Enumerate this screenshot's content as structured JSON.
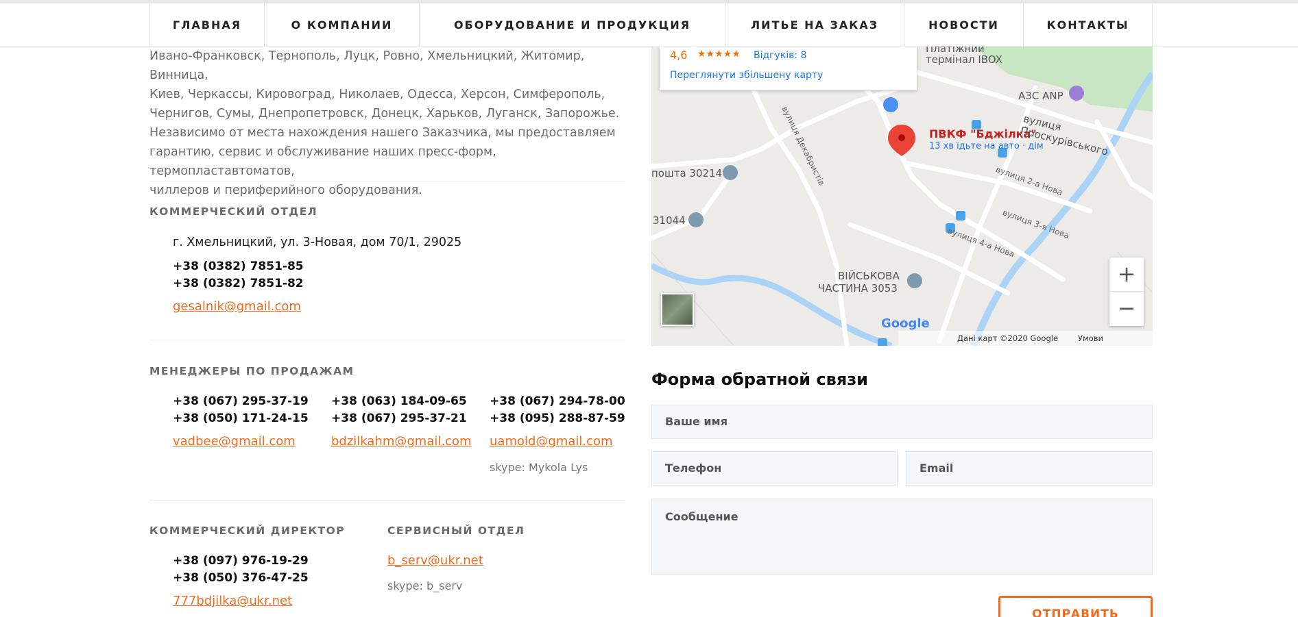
{
  "nav": [
    {
      "label": "ГЛАВНАЯ"
    },
    {
      "label": "О КОМПАНИИ"
    },
    {
      "label": "ОБОРУДОВАНИЕ И ПРОДУКЦИЯ"
    },
    {
      "label": "ЛИТЬЕ НА ЗАКАЗ"
    },
    {
      "label": "НОВОСТИ"
    },
    {
      "label": "КОНТАКТЫ"
    }
  ],
  "intro": {
    "lines": [
      "Ивано-Франковск, Тернополь, Луцк, Ровно, Хмельницкий, Житомир, Винница,",
      "Киев, Черкассы, Кировоград, Николаев, Одесса, Херсон, Симферополь,",
      "Чернигов, Сумы, Днепропетровск, Донецк, Харьков, Луганск, Запорожье.",
      "Независимо от места нахождения нашего Заказчика, мы предоставляем",
      "гарантию, сервис и обслуживание наших пресс-форм, термопластавтоматов,",
      "чиллеров и периферийного оборудования."
    ]
  },
  "commercial": {
    "title": "КОММЕРЧЕСКИЙ ОТДЕЛ",
    "address": "г. Хмельницкий, ул. 3-Новая, дом 70/1, 29025",
    "phones": [
      "+38 (0382) 7851-85",
      "+38 (0382) 7851-82"
    ],
    "email": "gesalnik@gmail.com"
  },
  "managers": {
    "title": "МЕНЕДЖЕРЫ ПО ПРОДАЖАМ",
    "items": [
      {
        "phones": [
          "+38 (067) 295-37-19",
          "+38 (050) 171-24-15"
        ],
        "email": "vadbee@gmail.com",
        "skype": ""
      },
      {
        "phones": [
          "+38 (063) 184-09-65",
          "+38 (067) 295-37-21"
        ],
        "email": "bdzilkahm@gmail.com",
        "skype": ""
      },
      {
        "phones": [
          "+38 (067) 294-78-00",
          "+38 (095) 288-87-59"
        ],
        "email": "uamold@gmail.com",
        "skype": "skype: Mykola Lys"
      }
    ]
  },
  "director": {
    "title": "КОММЕРЧЕСКИЙ ДИРЕКТОР",
    "phones": [
      "+38 (097) 976-19-29",
      "+38 (050) 376-47-25"
    ],
    "email": "777bdjilka@ukr.net"
  },
  "service": {
    "title": "СЕРВИСНЫЙ ОТДЕЛ",
    "email": "b_serv@ukr.net",
    "skype": "skype: b_serv"
  },
  "map": {
    "rating": "4,6",
    "stars": "★★★★★",
    "reviews": "Відгуків: 8",
    "view_larger": "Переглянути збільшену карту",
    "place_name": "ПВКФ \"Бджілка\"",
    "place_sub": "13 хв їдьте на авто · дім",
    "labels": {
      "terminal1": "Платіжний",
      "terminal2": "термінал IBOX",
      "azs": "АЗС ANP",
      "proskur": "вулиця Проскурівського",
      "post1": "пошта 30214",
      "post2": "31044",
      "decembr": "вулиця Декабристів",
      "nova2": "вулиця 2-а Нова",
      "nova3": "вулиця 3-я Нова",
      "nova4": "вулиця 4-а Нова",
      "military1": "ВІЙСЬКОВА",
      "military2": "ЧАСТИНА 3053",
      "google": "Google",
      "data": "Дані карт ©2020 Google",
      "terms": "Умови використання"
    },
    "zoom_in": "+",
    "zoom_out": "−",
    "colors": {
      "water": "#aad3f5",
      "park": "#c8e6c4",
      "road": "#ffffff",
      "pin": "#ea4335",
      "rating": "#e8710a",
      "link": "#1a73e8"
    }
  },
  "form": {
    "title": "Форма обратной связи",
    "name_placeholder": "Ваше имя",
    "phone_placeholder": "Телефон",
    "email_placeholder": "Email",
    "message_placeholder": "Сообщение",
    "submit": "ОТПРАВИТЬ"
  },
  "colors": {
    "accent": "#f26a1b",
    "field_bg": "#f4f7fa"
  }
}
